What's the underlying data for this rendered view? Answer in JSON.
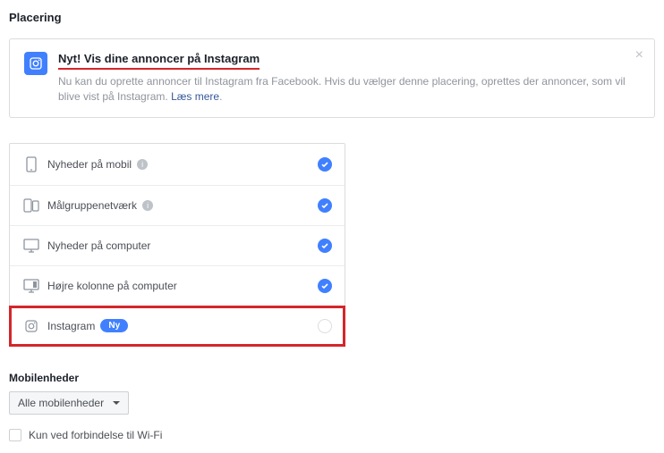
{
  "section_title": "Placering",
  "infobox": {
    "heading": "Nyt! Vis dine annoncer på Instagram",
    "body": "Nu kan du oprette annoncer til Instagram fra Facebook. Hvis du vælger denne placering, oprettes der annoncer, som vil blive vist på Instagram. ",
    "link": "Læs mere",
    "dot": "."
  },
  "placements": [
    {
      "label": "Nyheder på mobil",
      "info": true,
      "checked": true
    },
    {
      "label": "Målgruppenetværk",
      "info": true,
      "checked": true
    },
    {
      "label": "Nyheder på computer",
      "info": false,
      "checked": true
    },
    {
      "label": "Højre kolonne på computer",
      "info": false,
      "checked": true
    },
    {
      "label": "Instagram",
      "badge": "Ny",
      "info": false,
      "checked": false
    }
  ],
  "mobile": {
    "title": "Mobilenheder",
    "select_label": "Alle mobilenheder",
    "wifi_label": "Kun ved forbindelse til Wi-Fi"
  }
}
